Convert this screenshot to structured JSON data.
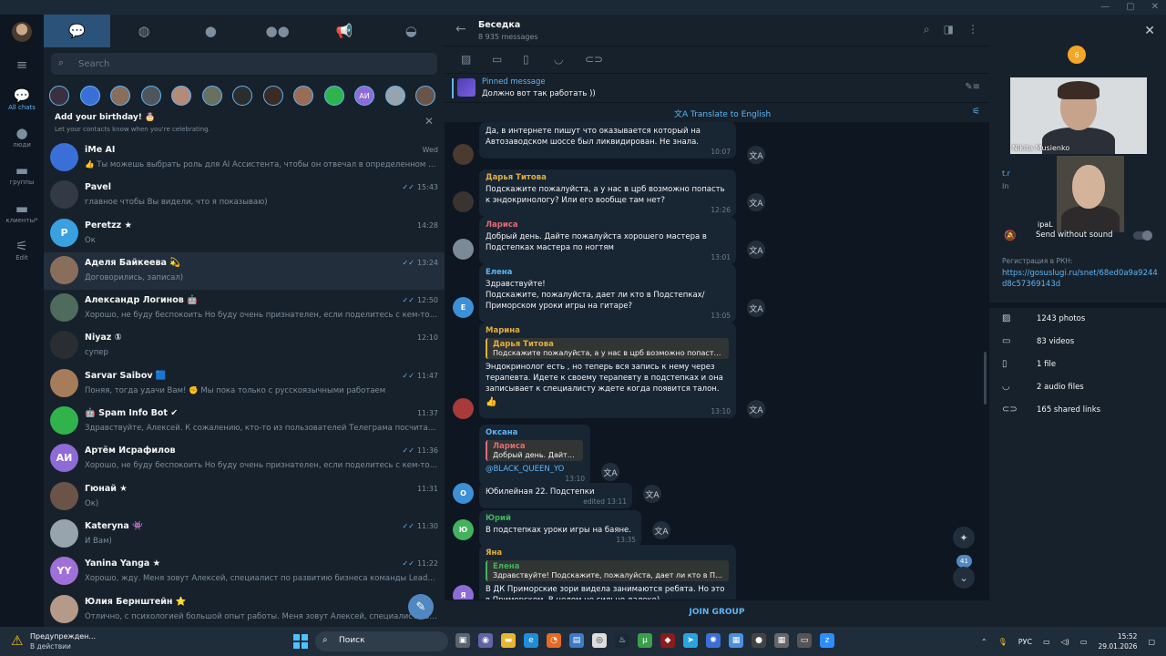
{
  "window": {
    "min_icon": "minimize-icon",
    "max_icon": "maximize-icon",
    "close_icon": "close-icon"
  },
  "rail": {
    "items": [
      {
        "label": "All chats",
        "icon": "chat-bubbles-icon"
      },
      {
        "label": "люди",
        "icon": "person-icon"
      },
      {
        "label": "группы",
        "icon": "folder-icon"
      },
      {
        "label": "клиенты*",
        "icon": "folder-icon"
      },
      {
        "label": "Edit",
        "icon": "sliders-icon"
      }
    ]
  },
  "left": {
    "search_placeholder": "Search",
    "story_initials": "АИ",
    "birthday_title": "Add your birthday! 🎂",
    "birthday_sub": "Let your contacts know when you're celebrating.",
    "chats": [
      {
        "name": "iMe AI",
        "preview": "👍 Ты можешь выбрать роль для AI Ассистента, чтобы он отвечал в определенном сти...",
        "time": "Wed",
        "initials": "",
        "color": "#3b6fd8",
        "check": ""
      },
      {
        "name": "Pavel",
        "preview": "главное чтобы Вы видели, что я показываю)",
        "time": "15:43",
        "initials": "",
        "color": "#333a45",
        "check": "✓✓"
      },
      {
        "name": "Peretzz ★",
        "preview": "Ок",
        "time": "14:28",
        "initials": "P",
        "color": "#3aa0e0",
        "check": ""
      },
      {
        "name": "Аделя Байкеева 💫",
        "preview": "Договорились, записал)",
        "time": "13:24",
        "initials": "",
        "color": "#8a6e5c",
        "check": "✓✓"
      },
      {
        "name": "Александр Логинов 🤖",
        "preview": "Хорошо, не буду беспокоить Но буду очень признателен, если поделитесь с кем-то кому н...",
        "time": "12:50",
        "initials": "",
        "color": "#4f6b5e",
        "check": "✓✓"
      },
      {
        "name": "Niyaz ①",
        "preview": "супер",
        "time": "12:10",
        "initials": "",
        "color": "#2a2e33",
        "check": ""
      },
      {
        "name": "Sarvar Saibov 🟦",
        "preview": "Поняя, тогда удачи Вам! ✊ Мы пока только с русскоязычными работаем",
        "time": "11:47",
        "initials": "",
        "color": "#a77c5a",
        "check": "✓✓"
      },
      {
        "name": "🤖 Spam Info Bot ✔",
        "preview": "Здравствуйте, Алексей. К сожалению, кто-то из пользователей Телеграма посчитал Ваши со...",
        "time": "11:37",
        "initials": "",
        "color": "#31b34c",
        "check": ""
      },
      {
        "name": "Артём Исрафилов",
        "preview": "Хорошо, не буду беспокоить Но буду очень признателен, если поделитесь с кем-то кому н...",
        "time": "11:36",
        "initials": "АИ",
        "color": "#8e6bd6",
        "check": "✓✓"
      },
      {
        "name": "Гюнай ★",
        "preview": "Ок)",
        "time": "11:31",
        "initials": "",
        "color": "#6b5447",
        "check": ""
      },
      {
        "name": "Kateryna 👾",
        "preview": "И Вам)",
        "time": "11:30",
        "initials": "",
        "color": "#97a3ad",
        "check": "✓✓"
      },
      {
        "name": "Yanina Yanga ★",
        "preview": "Хорошо, жду. Меня зовут Алексей, специалист по развитию бизнеса команды LeadBurn На...",
        "time": "11:22",
        "initials": "YY",
        "color": "#a070d8",
        "check": "✓✓"
      },
      {
        "name": "Юлия Бернштейн ⭐",
        "preview": "Отлично, с психологией большой опыт работы. Меня зовут Алексей, специалист по разв...",
        "time": "",
        "initials": "",
        "color": "#b59a8a",
        "check": ""
      }
    ]
  },
  "center": {
    "title": "Беседка",
    "subtitle": "8 935 messages",
    "pinned_title": "Pinned message",
    "pinned_text": "Должно вот так работать ))",
    "translate_label": "Translate to English",
    "join_label": "JOIN GROUP",
    "unread_count": "41",
    "messages": [
      {
        "author": "",
        "text": "Да, в интернете пишут что оказывается который на Автозаводском шоссе был ликвидирован. Не знала.",
        "time": "10:07"
      },
      {
        "author": "Дарья Титова",
        "text": "Подскажите пожалуйста, а у нас в црб возможно попасть к эндокринологу? Или его вообще там нет?",
        "time": "12:26"
      },
      {
        "author": "Лариса",
        "text": "Добрый день. Дайте пожалуйста хорошего мастера в Подстепках мастера по ногтям",
        "time": "13:01"
      },
      {
        "author": "Елена",
        "text": "Здравствуйте!\nПодскажите, пожалуйста, дает ли кто в Подстепках/Приморском уроки игры на гитаре?",
        "time": "13:05"
      },
      {
        "author": "Марина",
        "reply_name": "Дарья Титова",
        "reply_text": "Подскажите пожалуйста, а у нас в црб возможно попасть к э...",
        "text": "Эндокринолог есть , но теперь вся запись к нему через терапевта. Идете к своему терапевту в подстепках и она записывает к специалисту ждете когда появится талон.",
        "reactions": "👍",
        "time": "13:10"
      },
      {
        "author": "Оксана",
        "reply_name": "Лариса",
        "reply_text": "Добрый день. Дайте п...",
        "text": "@BLACK_QUEEN_YO",
        "time": "13:10"
      },
      {
        "author": "",
        "text": "Юбилейная 22. Подстепки",
        "time": "edited 13:11"
      },
      {
        "author": "Юрий",
        "text": "В подстепках уроки игры на баяне.",
        "time": "13:35"
      },
      {
        "author": "Яна",
        "reply_name": "Елена",
        "reply_text": "Здравствуйте! Подскажите, пожалуйста, дает ли кто в Подсте...",
        "text": "В ДК Приморские зори видела занимаются ребята. Но это в Приморском, В целом не сильно далеко)",
        "time": ""
      }
    ],
    "avatars": [
      {
        "initials": "",
        "color": "#4a3a30"
      },
      {
        "initials": "",
        "color": "#3a3430"
      },
      {
        "initials": "",
        "color": "#7a8a96"
      },
      {
        "initials": "Е",
        "color": "#3d8fd6"
      },
      {
        "initials": "",
        "color": "#a83a3a"
      },
      {
        "initials": "О",
        "color": "#3d8fd6"
      },
      {
        "initials": "Ю",
        "color": "#42b35c"
      },
      {
        "initials": "Я",
        "color": "#8e6bd6"
      }
    ]
  },
  "right": {
    "badge": "6",
    "video1_name": "Nikita Musienko",
    "video2_name": "ipaL",
    "partial_link": "t.r",
    "partial_sub": "In",
    "send_without_sound": "Send without sound",
    "reg_label": "Регистрация в РКН:",
    "reg_link": "https://gosuslugi.ru/snet/68ed0a9a9244d8c57369143d",
    "stats": [
      {
        "icon": "photo-icon",
        "label": "1243 photos"
      },
      {
        "icon": "video-icon",
        "label": "83 videos"
      },
      {
        "icon": "file-icon",
        "label": "1 file"
      },
      {
        "icon": "headphones-icon",
        "label": "2 audio files"
      },
      {
        "icon": "link-icon",
        "label": "165 shared links"
      }
    ]
  },
  "taskbar": {
    "warn_title": "Предупрежден...",
    "warn_sub": "В действии",
    "search_label": "Поиск",
    "lang": "РУС",
    "time": "15:52",
    "date": "29.01.2026"
  }
}
